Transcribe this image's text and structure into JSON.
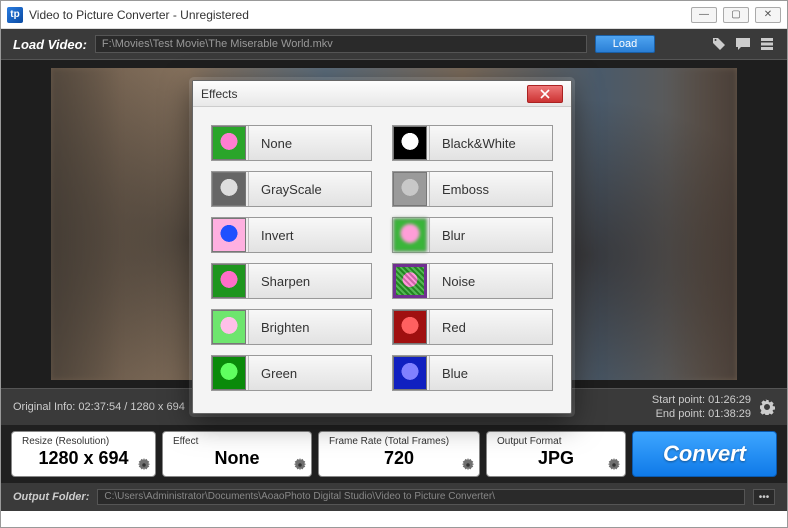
{
  "window": {
    "title": "Video to Picture Converter - Unregistered"
  },
  "loadrow": {
    "label": "Load Video:",
    "path": "F:\\Movies\\Test Movie\\The Miserable World.mkv",
    "button": "Load"
  },
  "info": {
    "original": "Original Info: 02:37:54 / 1280 x 694",
    "start": "Start point: 01:26:29",
    "end": "End point: 01:38:29"
  },
  "panels": {
    "resize_label": "Resize (Resolution)",
    "resize_value": "1280 x 694",
    "effect_label": "Effect",
    "effect_value": "None",
    "framerate_label": "Frame Rate (Total Frames)",
    "framerate_value": "720",
    "format_label": "Output Format",
    "format_value": "JPG",
    "convert": "Convert"
  },
  "output": {
    "label": "Output Folder:",
    "path": "C:\\Users\\Administrator\\Documents\\AoaoPhoto Digital Studio\\Video to Picture Converter\\"
  },
  "dialog": {
    "title": "Effects",
    "effects": [
      {
        "name": "None"
      },
      {
        "name": "Black&White"
      },
      {
        "name": "GrayScale"
      },
      {
        "name": "Emboss"
      },
      {
        "name": "Invert"
      },
      {
        "name": "Blur"
      },
      {
        "name": "Sharpen"
      },
      {
        "name": "Noise"
      },
      {
        "name": "Brighten"
      },
      {
        "name": "Red"
      },
      {
        "name": "Green"
      },
      {
        "name": "Blue"
      }
    ]
  }
}
